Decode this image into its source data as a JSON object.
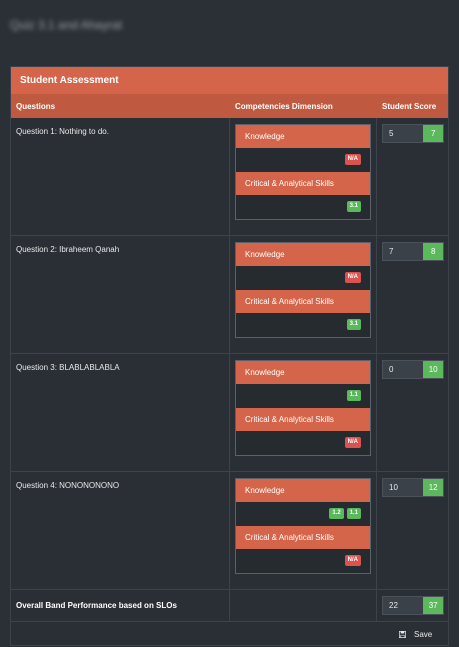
{
  "page": {
    "title": "Quiz 3.1 and Ahayrat"
  },
  "panel": {
    "title": "Student Assessment"
  },
  "columns": {
    "questions": "Questions",
    "competencies": "Competencies Dimension",
    "score": "Student Score"
  },
  "questions": [
    {
      "label": "Question 1: Nothing to do.",
      "score": "5",
      "max": "7",
      "competencies": [
        {
          "name": "Knowledge",
          "badges": [
            {
              "text": "N/A",
              "type": "red"
            }
          ]
        },
        {
          "name": "Critical & Analytical Skills",
          "badges": [
            {
              "text": "3.1",
              "type": "green"
            }
          ]
        }
      ]
    },
    {
      "label": "Question 2: Ibraheem Qanah",
      "score": "7",
      "max": "8",
      "competencies": [
        {
          "name": "Knowledge",
          "badges": [
            {
              "text": "N/A",
              "type": "red"
            }
          ]
        },
        {
          "name": "Critical & Analytical Skills",
          "badges": [
            {
              "text": "3.1",
              "type": "green"
            }
          ]
        }
      ]
    },
    {
      "label": "Question 3: BLABLABLABLA",
      "score": "0",
      "max": "10",
      "competencies": [
        {
          "name": "Knowledge",
          "badges": [
            {
              "text": "1.1",
              "type": "green"
            }
          ]
        },
        {
          "name": "Critical & Analytical Skills",
          "badges": [
            {
              "text": "N/A",
              "type": "red"
            }
          ]
        }
      ]
    },
    {
      "label": "Question 4: NONONONONO",
      "score": "10",
      "max": "12",
      "competencies": [
        {
          "name": "Knowledge",
          "badges": [
            {
              "text": "1.2",
              "type": "green"
            },
            {
              "text": "1.1",
              "type": "green"
            }
          ]
        },
        {
          "name": "Critical & Analytical Skills",
          "badges": [
            {
              "text": "N/A",
              "type": "red"
            }
          ]
        }
      ]
    }
  ],
  "overall": {
    "label": "Overall Band Performance based on SLOs",
    "score": "22",
    "max": "37"
  },
  "footer": {
    "save_label": "Save",
    "save_icon": "floppy-disk-icon"
  },
  "colors": {
    "accent": "#d4654a",
    "accent_dark": "#bf5a40",
    "green": "#5cb85c",
    "red": "#d9534f",
    "background": "#2b3036"
  }
}
